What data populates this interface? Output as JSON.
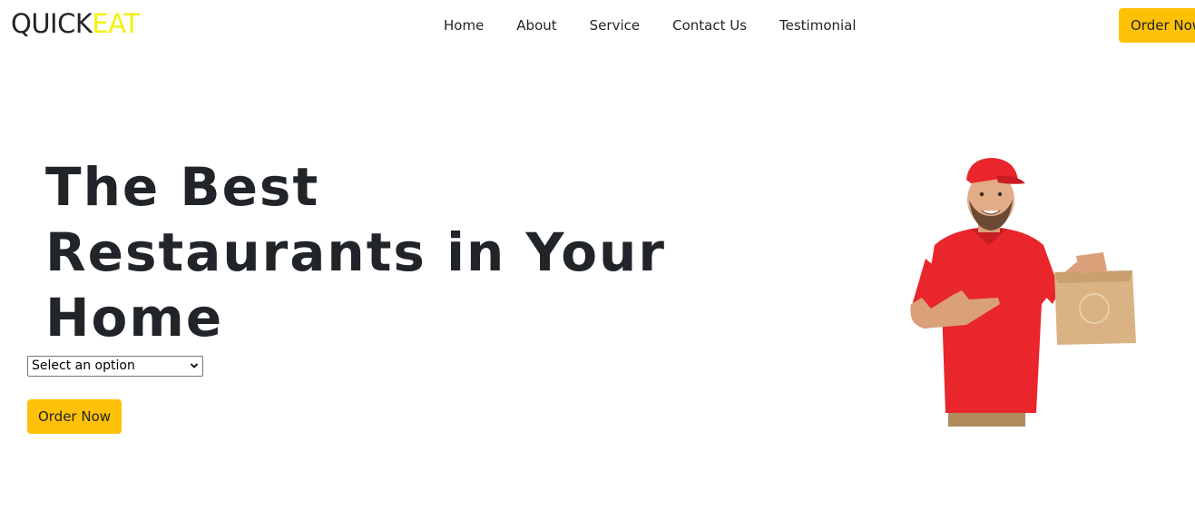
{
  "brand": {
    "part_a": "QUICK",
    "part_b": "EAT",
    "accent_color": "#f3f10a"
  },
  "nav": {
    "links": [
      "Home",
      "About",
      "Service",
      "Contact Us",
      "Testimonial"
    ],
    "order_label": "Order Now"
  },
  "hero": {
    "title_lines": [
      "The Best",
      "Restaurants in Your",
      "Home"
    ],
    "select_value": "Select an option",
    "order_label": "Order Now",
    "image_icon": "delivery-man-with-paper-bag-illustration"
  },
  "colors": {
    "button": "#ffc107",
    "text": "#212529",
    "shirt": "#e8262b",
    "bag": "#d9b384"
  }
}
